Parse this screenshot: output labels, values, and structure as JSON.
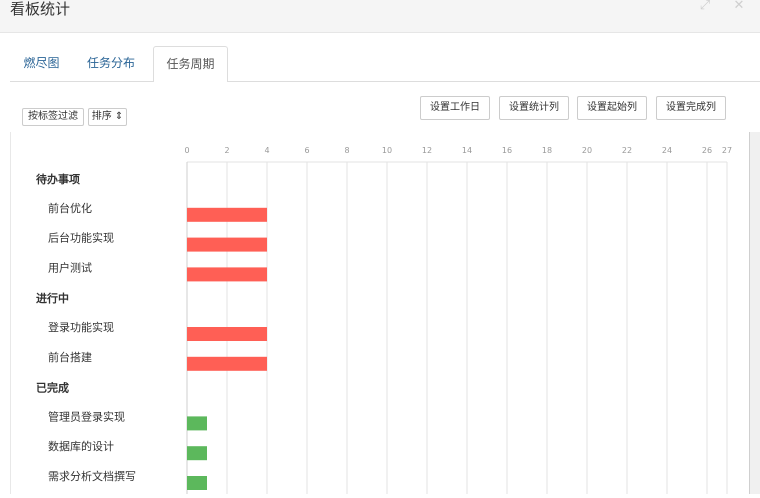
{
  "window": {
    "title": "看板统计",
    "expand_icon": "expand-icon",
    "close_icon": "close-icon"
  },
  "tabs": [
    {
      "label": "燃尽图",
      "active": false
    },
    {
      "label": "任务分布",
      "active": false
    },
    {
      "label": "任务周期",
      "active": true
    }
  ],
  "toolbar": {
    "filter_label": "按标签过滤",
    "sort_label": "排序",
    "set_workday_label": "设置工作日",
    "set_stat_columns_label": "设置统计列",
    "set_start_column_label": "设置起始列",
    "set_done_column_label": "设置完成列"
  },
  "colors": {
    "in_progress_bar": "#ff5f55",
    "done_bar": "#5cb85c",
    "grid": "#e3e3e3",
    "tab_link": "#2a6496"
  },
  "chart_data": {
    "type": "bar",
    "orientation": "horizontal",
    "x_ticks": [
      0,
      2,
      4,
      6,
      8,
      10,
      12,
      14,
      16,
      18,
      20,
      22,
      24,
      26,
      27
    ],
    "xlim": [
      0,
      27
    ],
    "grid": true,
    "groups": [
      {
        "name": "待办事项",
        "color": "#ff5f55",
        "items": [
          {
            "label": "前台优化",
            "value": 4
          },
          {
            "label": "后台功能实现",
            "value": 4
          },
          {
            "label": "用户测试",
            "value": 4
          }
        ]
      },
      {
        "name": "进行中",
        "color": "#ff5f55",
        "items": [
          {
            "label": "登录功能实现",
            "value": 4
          },
          {
            "label": "前台搭建",
            "value": 4
          }
        ]
      },
      {
        "name": "已完成",
        "color": "#5cb85c",
        "items": [
          {
            "label": "管理员登录实现",
            "value": 1
          },
          {
            "label": "数据库的设计",
            "value": 1
          },
          {
            "label": "需求分析文档撰写",
            "value": 1
          }
        ]
      }
    ]
  }
}
